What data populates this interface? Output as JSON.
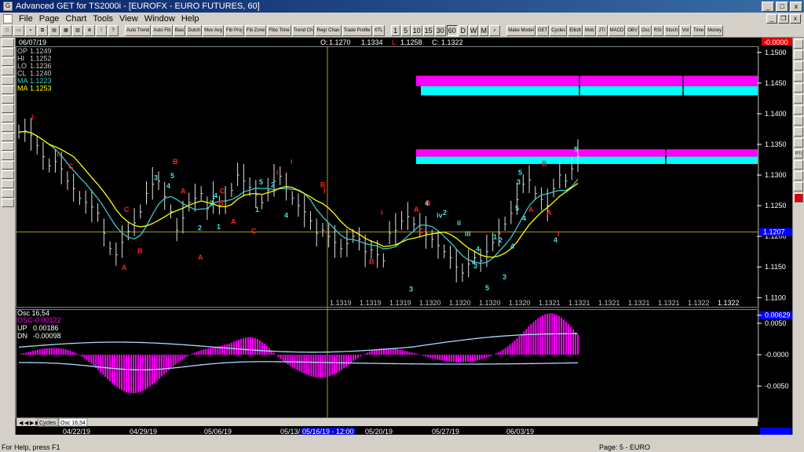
{
  "window": {
    "title": "Advanced GET for TS2000i - [EUROFX - EURO FUTURES, 60]"
  },
  "menu": {
    "items": [
      "File",
      "Page",
      "Chart",
      "Tools",
      "View",
      "Window",
      "Help"
    ]
  },
  "toolbar": {
    "buttons": [
      "Auto Trend",
      "Auto Fib",
      "Bias",
      "Dutch",
      "Mov Avg",
      "Fib Proj",
      "Fib Zone",
      "Fibo Time",
      "Trend Ch",
      "Regr Chan",
      "Trade Profile",
      "XTL"
    ],
    "intervals": [
      "1",
      "5",
      "10",
      "15",
      "30",
      "60",
      "D",
      "W",
      "M"
    ],
    "studies": [
      "Make Model",
      "GET",
      "Cycles",
      "Elliott",
      "Mob",
      "JTI",
      "MACD",
      "OBV",
      "Osc",
      "RSI",
      "Stoch",
      "Vol",
      "Time",
      "Money"
    ]
  },
  "header": {
    "date": "06/07/19",
    "ohlc_prefix_o": "O:",
    "open": "1.1270",
    "high": "1.1334",
    "low_prefix": "L:",
    "low": "1.1258",
    "close_prefix": "C:",
    "close": "1.1322",
    "change": "-0.0000"
  },
  "price_legend": [
    {
      "label": "OP",
      "value": "1.1249",
      "color": "#c8c8c8"
    },
    {
      "label": "HI",
      "value": "1.1252",
      "color": "#c8c8c8"
    },
    {
      "label": "LO",
      "value": "1.1236",
      "color": "#c8c8c8"
    },
    {
      "label": "CL",
      "value": "1.1240",
      "color": "#c8c8c8"
    },
    {
      "label": "MA",
      "value": "1.1223",
      "color": "#40c8c8"
    },
    {
      "label": "MA",
      "value": "1.1253",
      "color": "#ffff00"
    }
  ],
  "price_axis": {
    "ticks": [
      "1.1500",
      "1.1450",
      "1.1400",
      "1.1350",
      "1.1300",
      "1.1250",
      "1.1200",
      "1.1150",
      "1.1100"
    ],
    "current": "1.1207"
  },
  "time_axis_values": [
    "1.1319",
    "1.1319",
    "1.1319",
    "1.1320",
    "1.1320",
    "1.1320",
    "1.1320",
    "1.1321",
    "1.1321",
    "1.1321",
    "1.1321",
    "1.1321",
    "1.1322",
    "1.1322"
  ],
  "osc_legend": {
    "title": "Osc 16,54",
    "osc_label": "OSC",
    "osc_value": "-0.00122",
    "up_label": "UP",
    "up_value": "0.00186",
    "dn_label": "DN",
    "dn_value": "-0.00098"
  },
  "osc_axis": {
    "ticks": [
      "0.00629",
      "0.0050",
      "-0.0000",
      "-0.0050"
    ]
  },
  "tabs": [
    "Cycles",
    "Osc 16,54"
  ],
  "date_axis": [
    "04/22/19",
    "04/29/19",
    "05/06/19",
    "05/13/",
    "05/16/19 - 12:00",
    "05/20/19",
    "05/27/19",
    "06/03/19"
  ],
  "waves": {
    "red": [
      "i",
      "ii",
      "C",
      "B",
      "A",
      "C",
      "B",
      "A",
      "C",
      "B",
      "A",
      "C",
      "i",
      "i",
      "B",
      "A",
      "i",
      "B",
      "A",
      "C",
      "B",
      "B",
      "A",
      "A",
      "i",
      "i"
    ],
    "cyan": [
      "3",
      "4",
      "5",
      "2",
      "1",
      "3",
      "4",
      "5",
      "2",
      "1",
      "4",
      "3",
      "4",
      "iv",
      "2",
      "ii",
      "iii",
      "4",
      "v",
      "3",
      "5",
      "1",
      "2",
      "3",
      "4",
      "5",
      "4",
      "5",
      "3",
      "5",
      "4"
    ]
  },
  "colors": {
    "magenta": "#ff00ff",
    "cyan": "#00ffff",
    "yellow": "#ffff00",
    "wave_red": "#ff2020",
    "wave_cyan": "#40e0e0",
    "price_bar": "#e0e0e0"
  },
  "status": {
    "left": "For Help, press F1",
    "page": "Page: 5 - EURO"
  }
}
